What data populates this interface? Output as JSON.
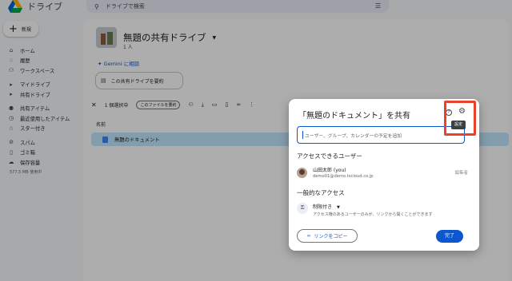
{
  "app": {
    "title": "ドライブ"
  },
  "search": {
    "placeholder": "ドライブで検索"
  },
  "sidebar": {
    "new_label": "新規",
    "items": [
      {
        "label": "ホーム",
        "icon": "home-icon"
      },
      {
        "label": "履歴",
        "icon": "activity-icon"
      },
      {
        "label": "ワークスペース",
        "icon": "workspace-icon"
      },
      {
        "label": "マイドライブ",
        "icon": "my-drive-icon"
      },
      {
        "label": "共有ドライブ",
        "icon": "shared-drive-icon"
      },
      {
        "label": "共有アイテム",
        "icon": "people-icon"
      },
      {
        "label": "最近使用したアイテム",
        "icon": "clock-icon"
      },
      {
        "label": "スター付き",
        "icon": "star-icon"
      },
      {
        "label": "スパム",
        "icon": "spam-icon"
      },
      {
        "label": "ゴミ箱",
        "icon": "trash-icon"
      },
      {
        "label": "保存容量",
        "icon": "cloud-icon"
      }
    ],
    "storage_used": "577.5 MB 使用中"
  },
  "main": {
    "drive_title": "無題の共有ドライブ",
    "members": "1 人",
    "gemini_link": "Gemini に相談",
    "summary_chip": "この共有ドライブを要約",
    "selection": "1 個選択中",
    "toolbar_pill": "このファイルを要約",
    "column_name": "名前",
    "file_name": "無題のドキュメント"
  },
  "dialog": {
    "title": "「無題のドキュメント」を共有",
    "settings_tooltip": "設定",
    "input_placeholder": "ユーザー、グループ、カレンダーの予定を追加",
    "people_header": "アクセスできるユーザー",
    "user": {
      "name": "山田太郎 (you)",
      "email": "demo01@demo.tscloud.co.jp",
      "role": "編集者"
    },
    "general_header": "一般的なアクセス",
    "access_level": "制限付き",
    "access_desc": "アクセス権のあるユーザーのみが、リンクから開くことができます",
    "copy_link": "リンクをコピー",
    "done": "完了"
  },
  "colors": {
    "accent": "#0b57d0",
    "highlight": "#e8422d",
    "selected_row": "#c2e7ff"
  }
}
